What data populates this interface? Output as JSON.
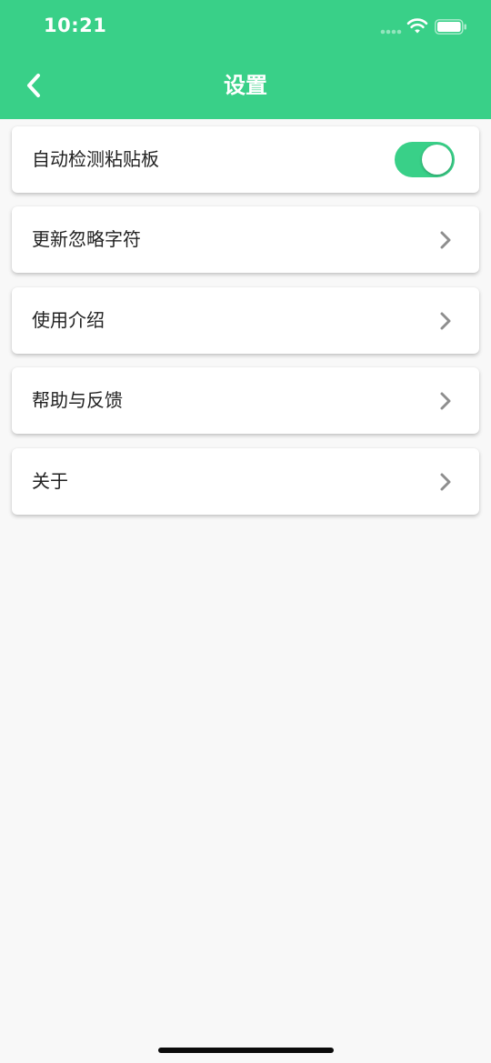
{
  "status_bar": {
    "time": "10:21",
    "signal_icon": "signal-dots-icon",
    "wifi_icon": "wifi-icon",
    "battery_icon": "battery-icon"
  },
  "header": {
    "title": "设置",
    "back_icon": "chevron-left-icon",
    "background_color": "#39d088"
  },
  "settings": {
    "items": [
      {
        "label": "自动检测粘贴板",
        "type": "toggle",
        "toggle_on": true
      },
      {
        "label": "更新忽略字符",
        "type": "link",
        "icon": "chevron-right-icon"
      },
      {
        "label": "使用介绍",
        "type": "link",
        "icon": "chevron-right-icon"
      },
      {
        "label": "帮助与反馈",
        "type": "link",
        "icon": "chevron-right-icon"
      },
      {
        "label": "关于",
        "type": "link",
        "icon": "chevron-right-icon"
      }
    ]
  },
  "colors": {
    "accent": "#39d088",
    "background": "#f8f8f8",
    "card": "#ffffff",
    "text": "#222222",
    "chevron": "#8e8e8e"
  }
}
